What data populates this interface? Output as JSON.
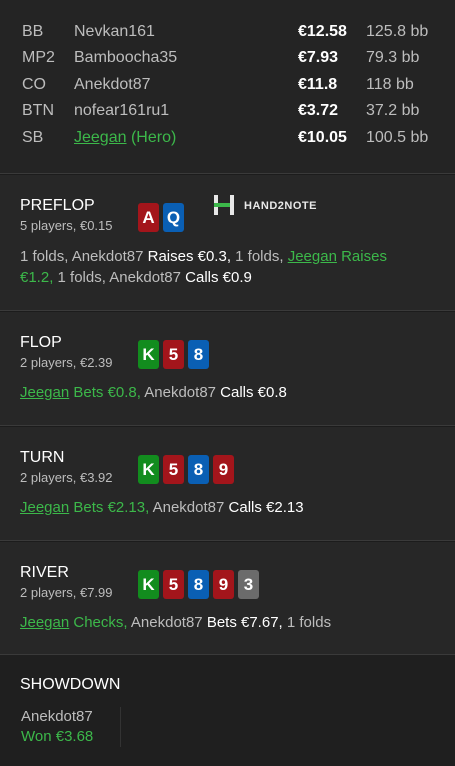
{
  "players": [
    {
      "pos": "BB",
      "name": "Nevkan161",
      "stack": "€12.58",
      "bb": "125.8 bb"
    },
    {
      "pos": "MP2",
      "name": "Bamboocha35",
      "stack": "€7.93",
      "bb": "79.3 bb"
    },
    {
      "pos": "CO",
      "name": "Anekdot87",
      "stack": "€11.8",
      "bb": "118 bb"
    },
    {
      "pos": "BTN",
      "name": "nofear161ru1",
      "stack": "€3.72",
      "bb": "37.2 bb"
    },
    {
      "pos": "SB",
      "name": "Jeegan",
      "hero_tag": "(Hero)",
      "stack": "€10.05",
      "bb": "100.5 bb"
    }
  ],
  "logo": {
    "text": "HAND2NOTE"
  },
  "colors": {
    "red": "#a3151b",
    "blue": "#0a5fb4",
    "green": "#128c1e",
    "gray": "#6b6b6b",
    "hero": "#3cb84a"
  },
  "preflop": {
    "title": "PREFLOP",
    "sub": "5 players, €0.15",
    "cards": [
      {
        "rank": "A",
        "suit": "red"
      },
      {
        "rank": "Q",
        "suit": "blue"
      }
    ],
    "a1": "1 folds, Anekdot87 ",
    "a2": "Raises €0.3,",
    "a3": " 1 folds, ",
    "a4": "Jeegan",
    "a5": " Raises",
    "a6": "€1.2,",
    "a7": " 1 folds, Anekdot87 ",
    "a8": "Calls €0.9"
  },
  "flop": {
    "title": "FLOP",
    "sub": "2 players, €2.39",
    "cards": [
      {
        "rank": "K",
        "suit": "green"
      },
      {
        "rank": "5",
        "suit": "red"
      },
      {
        "rank": "8",
        "suit": "blue"
      }
    ],
    "a1": "Jeegan",
    "a2": " Bets €0.8,",
    "a3": " Anekdot87 ",
    "a4": "Calls €0.8"
  },
  "turn": {
    "title": "TURN",
    "sub": "2 players, €3.92",
    "cards": [
      {
        "rank": "K",
        "suit": "green"
      },
      {
        "rank": "5",
        "suit": "red"
      },
      {
        "rank": "8",
        "suit": "blue"
      },
      {
        "rank": "9",
        "suit": "red"
      }
    ],
    "a1": "Jeegan",
    "a2": " Bets €2.13,",
    "a3": " Anekdot87 ",
    "a4": "Calls €2.13"
  },
  "river": {
    "title": "RIVER",
    "sub": "2 players, €7.99",
    "cards": [
      {
        "rank": "K",
        "suit": "green"
      },
      {
        "rank": "5",
        "suit": "red"
      },
      {
        "rank": "8",
        "suit": "blue"
      },
      {
        "rank": "9",
        "suit": "red"
      },
      {
        "rank": "3",
        "suit": "gray"
      }
    ],
    "a1": "Jeegan",
    "a2": " Checks,",
    "a3": " Anekdot87 ",
    "a4": "Bets €7.67,",
    "a5": " 1 folds"
  },
  "showdown": {
    "title": "SHOWDOWN",
    "name": "Anekdot87",
    "won": "Won €3.68"
  }
}
